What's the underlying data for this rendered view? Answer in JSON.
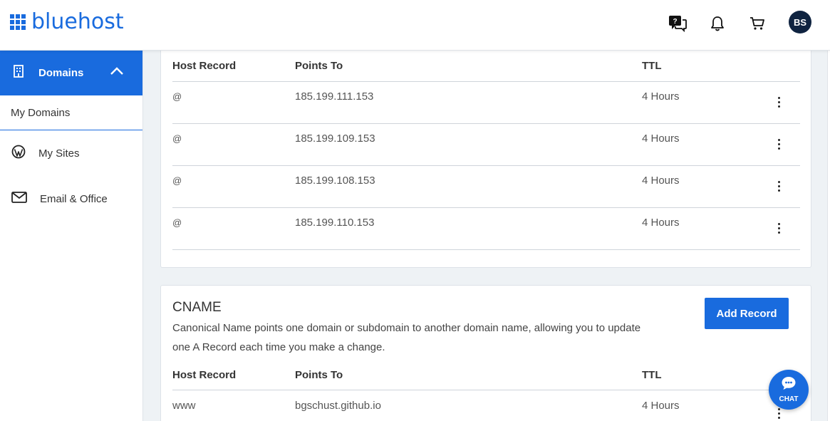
{
  "header": {
    "logo_text": "bluehost",
    "avatar_initials": "BS",
    "icons": [
      "help-chat-icon",
      "bell-icon",
      "cart-icon"
    ]
  },
  "sidebar": {
    "active": {
      "label": "Domains",
      "icon": "building-icon"
    },
    "sub_item": "My Domains",
    "items": [
      {
        "label": "My Sites",
        "icon": "wordpress-icon"
      },
      {
        "label": "Email & Office",
        "icon": "mail-icon"
      }
    ]
  },
  "a_records": {
    "headers": {
      "host": "Host Record",
      "points": "Points To",
      "ttl": "TTL"
    },
    "rows": [
      {
        "host": "@",
        "points": "185.199.111.153",
        "ttl": "4 Hours"
      },
      {
        "host": "@",
        "points": "185.199.109.153",
        "ttl": "4 Hours"
      },
      {
        "host": "@",
        "points": "185.199.108.153",
        "ttl": "4 Hours"
      },
      {
        "host": "@",
        "points": "185.199.110.153",
        "ttl": "4 Hours"
      }
    ]
  },
  "cname": {
    "title": "CNAME",
    "description": "Canonical Name points one domain or subdomain to another domain name, allowing you to update one A Record each time you make a change.",
    "add_button": "Add Record",
    "headers": {
      "host": "Host Record",
      "points": "Points To",
      "ttl": "TTL"
    },
    "rows": [
      {
        "host": "www",
        "points": "bgschust.github.io",
        "ttl": "4 Hours"
      }
    ]
  },
  "chat": {
    "label": "CHAT"
  },
  "colors": {
    "brand": "#196bde",
    "avatar_bg": "#0f2340"
  }
}
